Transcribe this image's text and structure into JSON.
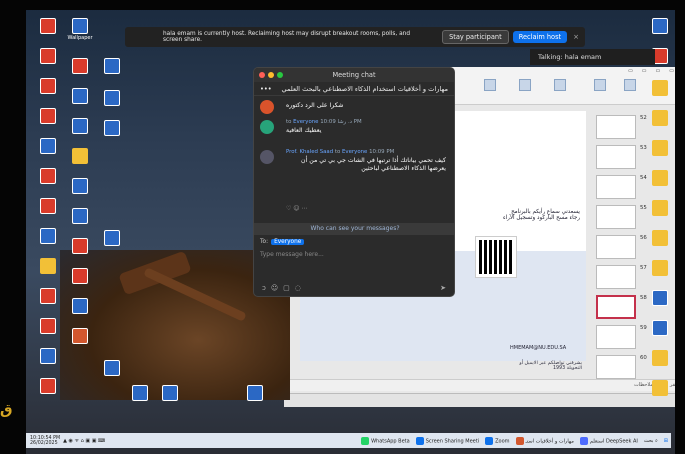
{
  "notification": {
    "message": "hala emam is currently host. Reclaiming host may disrupt breakout rooms, polls, and screen share.",
    "stay_label": "Stay participant",
    "reclaim_label": "Reclaim host",
    "close": "×",
    "talking": "Talking: hala emam"
  },
  "desktop": {
    "wallpaper_label": "Wallpaper"
  },
  "chat": {
    "title": "Meeting chat",
    "subject": "مهارات و أخلاقيات استخدام الذكاء الاصطناعي بالبحث العلمي",
    "more": "•••",
    "messages": [
      {
        "text": "شكرا على الرد دكتوره"
      },
      {
        "to": "to",
        "recipient": "Everyone",
        "sender": "د. رشا",
        "time": "10:09 PM",
        "text": "يعطيك العافية"
      },
      {
        "sender": "Prof. Khaled Saad",
        "to": "to",
        "recipient": "Everyone",
        "time": "10:09 PM",
        "text": "كيف تحمي بياناتك أذا ترتبها في الشات جي بي تي من أن يعرضها الذكاء الاصطناعي لباحثين"
      }
    ],
    "who_can_see": "Who can see your messages?",
    "to_label": "To:",
    "to_value": "Everyone",
    "placeholder": "Type message here..."
  },
  "slide": {
    "title": "يسعدني سماع رأيكم بالبرنامج رجاء مسح الباركود وتسجيل الآراء",
    "email": "HMEMAM@NU.EDU.SA",
    "contact": "يشرفني تواصلكم عبر الايميل أو التحويلة 1993",
    "notes": "انقر لإضافة ملاحظات",
    "thumbnail_numbers": [
      "52",
      "53",
      "54",
      "55",
      "56",
      "57",
      "58",
      "59",
      "60"
    ]
  },
  "taskbar": {
    "items": [
      "WhatsApp Beta",
      "Screen Sharing Meeti",
      "Zoom",
      "مهارات و أخلاقيات استـ",
      "استعلم DeepSeek AI",
      "بحث"
    ],
    "clock_time": "10:10:54 PM",
    "clock_date": "26/02/2025"
  },
  "colors": {
    "accent": "#0e71eb",
    "slide_selected": "#c4314b"
  }
}
